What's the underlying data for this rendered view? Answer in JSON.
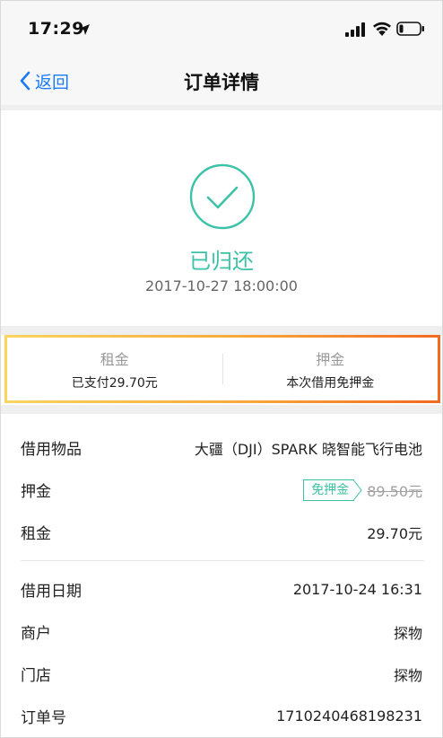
{
  "status_bar": {
    "time": "17:29"
  },
  "nav": {
    "back_label": "返回",
    "title": "订单详情"
  },
  "order_status": {
    "label": "已归还",
    "time": "2017-10-27 18:00:00"
  },
  "summary": {
    "rent_title": "租金",
    "rent_value": "已支付29.70元",
    "deposit_title": "押金",
    "deposit_value": "本次借用免押金"
  },
  "details": {
    "item": {
      "label": "借用物品",
      "value": "大疆（DJI）SPARK 晓智能飞行电池"
    },
    "deposit": {
      "label": "押金",
      "tag": "免押金",
      "original": "89.50元"
    },
    "rent": {
      "label": "租金",
      "value": "29.70元"
    },
    "date": {
      "label": "借用日期",
      "value": "2017-10-24 16:31"
    },
    "merchant": {
      "label": "商户",
      "value": "探物"
    },
    "store": {
      "label": "门店",
      "value": "探物"
    },
    "order_no": {
      "label": "订单号",
      "value": "1710240468198231"
    }
  },
  "colors": {
    "accent": "#3cc2a6",
    "link": "#1a7cf5",
    "border_start": "#fcd55e",
    "border_end": "#f26a22"
  }
}
